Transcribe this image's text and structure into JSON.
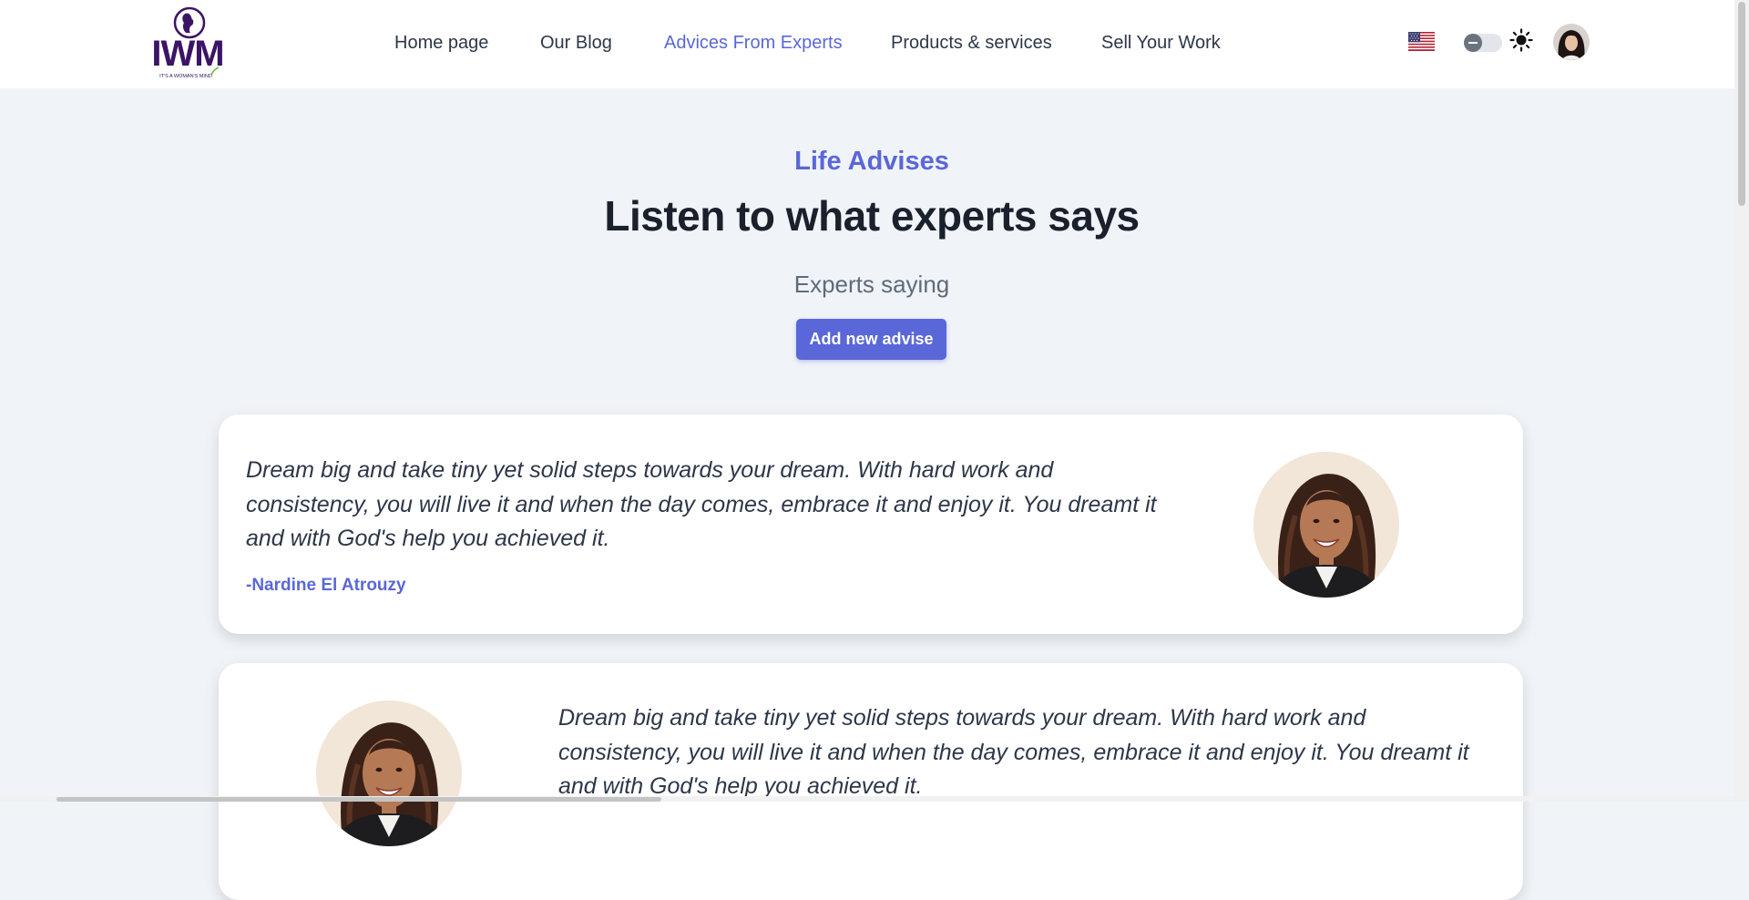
{
  "brand": {
    "logo_text": "IWM",
    "logo_tagline": "IT'S A WOMAN'S MIND"
  },
  "nav": {
    "items": [
      {
        "label": "Home page"
      },
      {
        "label": "Our Blog"
      },
      {
        "label": "Advices From Experts",
        "active": true
      },
      {
        "label": "Products & services"
      },
      {
        "label": "Sell Your Work"
      }
    ]
  },
  "header_controls": {
    "language_flag": "us-flag-icon",
    "theme_toggle_state": "off",
    "theme_icon": "sun-icon",
    "profile_avatar": "avatar"
  },
  "hero": {
    "kicker": "Life Advises",
    "title": "Listen to what experts says",
    "subtitle": "Experts saying",
    "add_button_label": "Add new advise"
  },
  "advices": [
    {
      "quote": "Dream big and take tiny yet solid steps towards your dream. With hard work and consistency, you will live it and when the day comes, embrace it and enjoy it. You dreamt it and with God's help you achieved it.",
      "author": "-Nardine El Atrouzy"
    },
    {
      "quote": "Dream big and take tiny yet solid steps towards your dream. With hard work and consistency, you will live it and when the day comes, embrace it and enjoy it. You dreamt it and with God's help you achieved it."
    }
  ],
  "colors": {
    "accent": "#5a67d8",
    "page_background": "#f0f3f8",
    "heading": "#1a202c",
    "body_text": "#2d3748",
    "logo_purple": "#3b1466"
  }
}
